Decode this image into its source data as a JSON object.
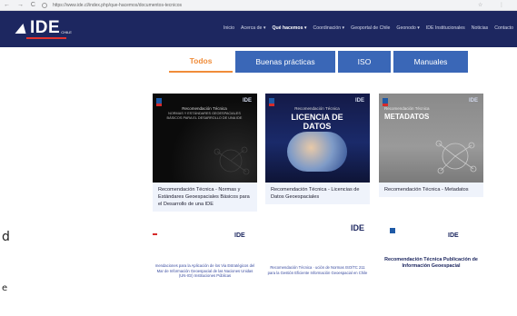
{
  "browser": {
    "nav_icons": "← → C",
    "url": "https://www.ide.cl/index.php/que-hacemos/documentos-tecnicos",
    "right_icons": "☆ ⋮"
  },
  "site": {
    "logo_text": "IDE",
    "logo_suffix": "CHILE",
    "menu": [
      {
        "label": "Inicio"
      },
      {
        "label": "Acerca de ▾"
      },
      {
        "label": "Qué hacemos ▾"
      },
      {
        "label": "Coordinación ▾"
      },
      {
        "label": "Geoportal de Chile"
      },
      {
        "label": "Geonodo ▾"
      },
      {
        "label": "IDE Institucionales"
      },
      {
        "label": "Noticias"
      },
      {
        "label": "Contacto"
      }
    ]
  },
  "tabs": [
    {
      "label": "Todos"
    },
    {
      "label": "Buenas prácticas"
    },
    {
      "label": "ISO"
    },
    {
      "label": "Manuales"
    }
  ],
  "cards": [
    {
      "caption": "Recomendación Técnica - Normas y Estándares Geoespaciales Básicos para el Desarrollo de una IDE",
      "thumb_title": "Recomendación Técnica",
      "thumb_heading": "NORMAS Y ESTÁNDARES GEOESPACIALES BÁSICOS PARA EL DESARROLLO DE UNA IDE",
      "brand": "IDE"
    },
    {
      "caption": "Recomendación Técnica - Licencias de Datos Geoespaciales",
      "thumb_title": "Recomendación Técnica",
      "thumb_heading": "LICENCIA DE DATOS",
      "brand": "IDE"
    },
    {
      "caption": "Recomendación Técnica - Metadatos",
      "thumb_title": "Recomendación Técnica",
      "thumb_heading": "METADATOS",
      "brand": "IDE"
    }
  ],
  "lower_cards": [
    {
      "brand": "IDE",
      "text": "mendaciones para la Aplicación de los Via Estratégicos del Mar de Información Geoespacial de las Naciones Unidas (UN-IGI) Instituciones Públicas"
    },
    {
      "brand": "IDE",
      "text": "Recomendación Técnica · ución de Normas ISO/TC 211 para la Gestión Eficiente Información Geoespacial en Chile"
    },
    {
      "brand": "IDE",
      "text": "Recomendación Técnica Publicación de Información Geoespacial"
    }
  ],
  "edge": {
    "glyph1": "d",
    "glyph2": "e"
  }
}
